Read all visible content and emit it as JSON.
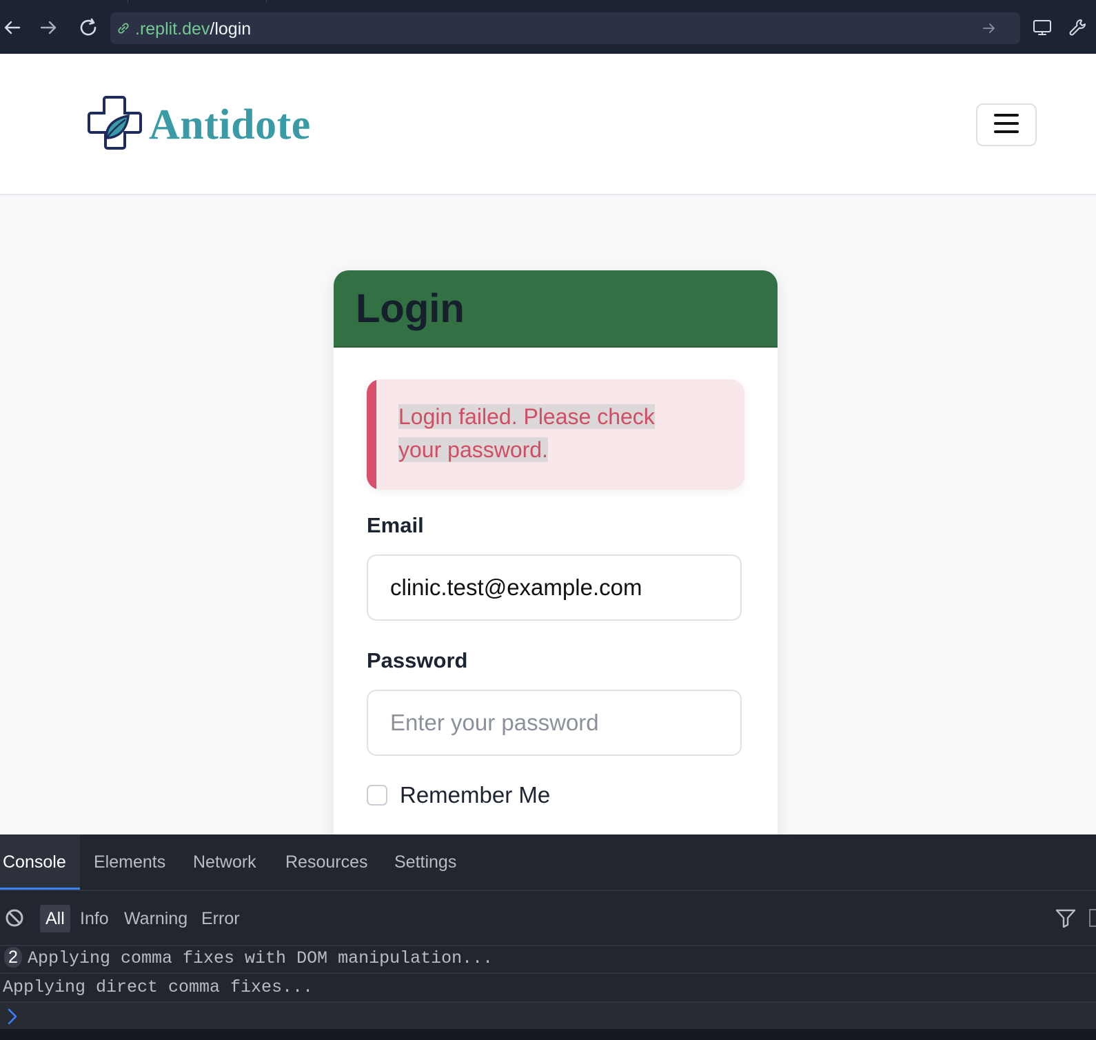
{
  "browser": {
    "url_host": ".replit.dev",
    "url_path": "/login"
  },
  "navbar": {
    "brand": "Antidote"
  },
  "login": {
    "title": "Login",
    "alert": {
      "line1": "Login failed. Please check",
      "line2": "your password."
    },
    "email_label": "Email",
    "email_value": "clinic.test@example.com",
    "password_label": "Password",
    "password_placeholder": "Enter your password",
    "remember_label": "Remember Me"
  },
  "devtools": {
    "tabs": [
      "Console",
      "Elements",
      "Network",
      "Resources",
      "Settings"
    ],
    "filters": [
      "All",
      "Info",
      "Warning",
      "Error"
    ],
    "logs": [
      {
        "count": "2",
        "text": "Applying comma fixes with DOM manipulation..."
      },
      {
        "text": "Applying direct comma fixes..."
      }
    ]
  },
  "colors": {
    "brand": "#3a9aa5",
    "card_header": "#337044",
    "alert_text": "#d14d63",
    "devtools_active": "#3b82f6"
  }
}
